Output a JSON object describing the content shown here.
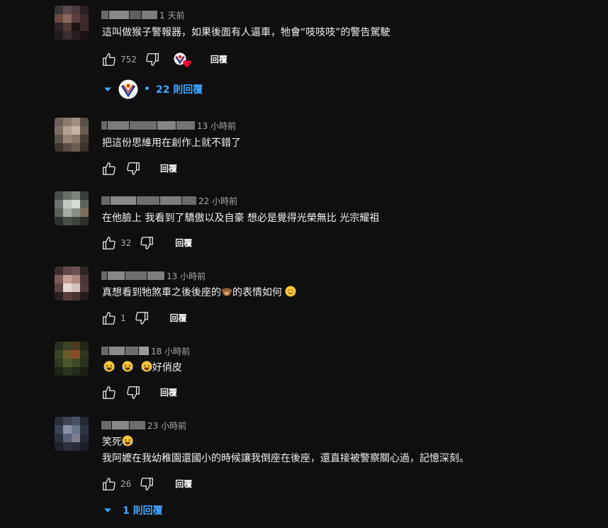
{
  "comments": [
    {
      "time": "1 天前",
      "text": "這叫做猴子警報器，如果後面有人逼車，牠會“吱吱吱”的警告駕駛",
      "likes": "752",
      "reply_label": "回覆",
      "replies_label": "22 則回覆"
    },
    {
      "time": "13 小時前",
      "text": "把這份思維用在創作上就不錯了",
      "likes": "",
      "reply_label": "回覆"
    },
    {
      "time": "22 小時前",
      "text": "在他臉上 我看到了驕傲以及自豪 想必是覺得光榮無比 光宗耀祖",
      "likes": "32",
      "reply_label": "回覆"
    },
    {
      "time": "13 小時前",
      "text_before": "真想看到牠煞車之後後座的",
      "text_middle": "的表情如何",
      "likes": "1",
      "reply_label": "回覆"
    },
    {
      "time": "18 小時前",
      "text": "好俏皮",
      "likes": "",
      "reply_label": "回覆"
    },
    {
      "time": "23 小時前",
      "text_line1": "笑死",
      "text_line2": "我阿嬤在我幼稚園還國小的時候讓我倒座在後座，還直接被警察關心過，記憶深刻。",
      "likes": "26",
      "reply_label": "回覆",
      "replies_label": "1 則回覆"
    }
  ],
  "colors": {
    "background": "#0f0f0f",
    "text_primary": "#f1f1f1",
    "text_secondary": "#aaaaaa",
    "link_blue": "#3ea6ff",
    "heart_red": "#ff0033"
  }
}
